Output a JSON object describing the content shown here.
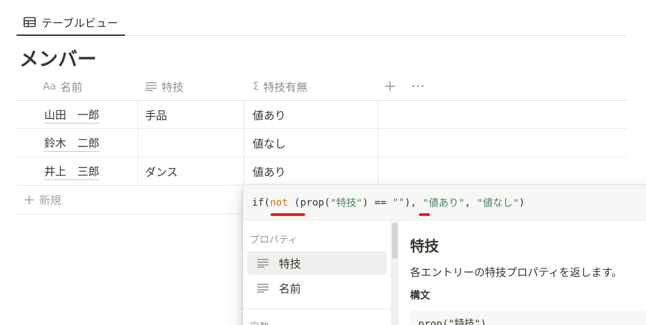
{
  "view_tab": {
    "label": "テーブルビュー",
    "icon": "table-icon"
  },
  "database": {
    "title": "メンバー"
  },
  "columns": [
    {
      "icon_text": "Aa",
      "label": "名前"
    },
    {
      "icon": "text-lines-icon",
      "label": "特技"
    },
    {
      "icon_text": "Σ",
      "label": "特技有無"
    }
  ],
  "header_actions": {
    "add": "+",
    "more": "···"
  },
  "rows": [
    {
      "name": "山田　一郎",
      "skill": "手品",
      "has": "値あり"
    },
    {
      "name": "鈴木　二郎",
      "skill": "",
      "has": "値なし"
    },
    {
      "name": "井上　三郎",
      "skill": "ダンス",
      "has": "値あり"
    }
  ],
  "new_row": {
    "plus": "+",
    "label": "新規"
  },
  "formula_editor": {
    "tokens": {
      "if_open": "if(",
      "not_kw": "not",
      "paren_prop": " (prop(",
      "str_prop": "\"特技\"",
      "close_eq": ") == ",
      "str_empty": "\"\"",
      "close_comma": "), ",
      "str_yes": "\"値あり\"",
      "comma": ", ",
      "str_no": "\"値なし\"",
      "end": ")"
    },
    "sidebar": {
      "section_label": "プロパティ",
      "items": [
        {
          "label": "特技",
          "icon": "text-lines-icon",
          "selected": true
        },
        {
          "label": "名前",
          "icon": "text-lines-icon",
          "selected": false
        }
      ],
      "next_section_label": "定数"
    },
    "detail": {
      "title": "特技",
      "description": "各エントリーの特技プロパティを返します。",
      "syntax_label": "構文",
      "syntax_code": "prop(\"特技\")"
    },
    "colors": {
      "keyword": "#d9730d",
      "string": "#448361",
      "underline": "#e02020"
    }
  }
}
